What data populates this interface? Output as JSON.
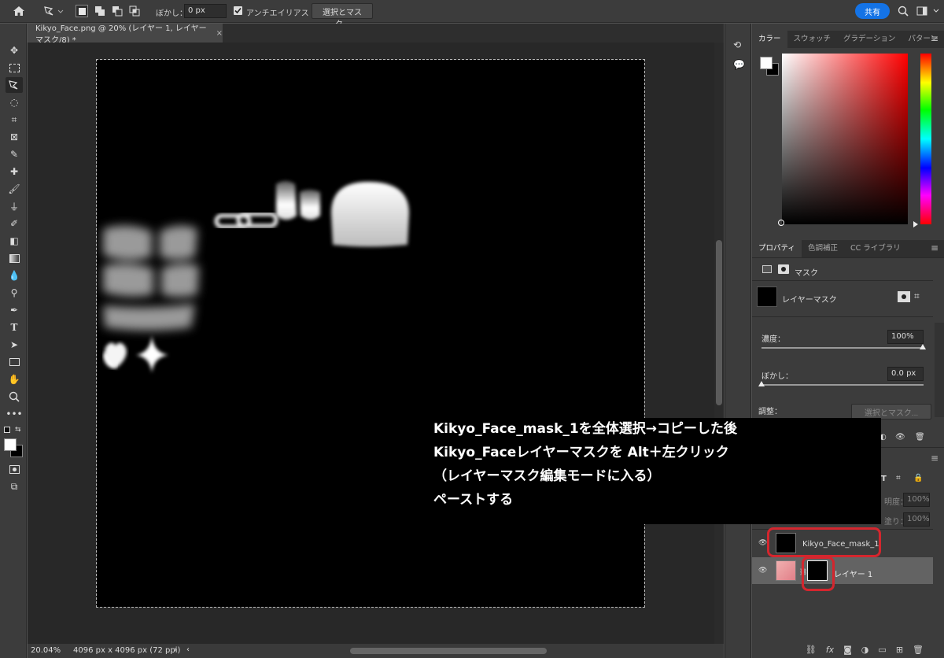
{
  "options_bar": {
    "feather_label": "ぼかし：",
    "feather_value": "0 px",
    "antialias_label": "アンチエイリアス",
    "select_mask_button": "選択とマスク...",
    "share_button": "共有"
  },
  "document": {
    "tab_title": "Kikyo_Face.png @ 20% (レイヤー 1, レイヤーマスク/8) *",
    "zoom": "20.04%",
    "dimensions": "4096 px x 4096 px (72 ppi)"
  },
  "color_panel": {
    "tabs": [
      "カラー",
      "スウォッチ",
      "グラデーション",
      "パターン"
    ],
    "active_tab": "カラー"
  },
  "properties_panel": {
    "tabs": [
      "プロパティ",
      "色調補正",
      "CC ライブラリ"
    ],
    "mask_label": "マスク",
    "layer_mask_label": "レイヤーマスク",
    "density_label": "濃度：",
    "density_value": "100%",
    "feather_label": "ぼかし：",
    "feather_value": "0.0 px",
    "adjust_label": "調整：",
    "select_mask_button": "選択とマスク..."
  },
  "layers_panel": {
    "opacity_label": "明度：",
    "opacity_value": "100%",
    "fill_label": "塗り：",
    "fill_value": "100%",
    "layers": [
      {
        "name": "Kikyo_Face_mask_1",
        "visible": true,
        "selected": false
      },
      {
        "name": "レイヤー 1",
        "visible": true,
        "selected": true
      }
    ]
  },
  "annotation": {
    "lines": [
      "Kikyo_Face_mask_1を全体選択→コピーした後",
      "Kikyo_Faceレイヤーマスクを Alt＋左クリック",
      "（レイヤーマスク編集モードに入る）",
      "ペーストする"
    ],
    "highlight_color": "#d4262e"
  },
  "colors": {
    "foreground": "#ffffff",
    "background": "#000000",
    "accent": "#1473e6"
  }
}
